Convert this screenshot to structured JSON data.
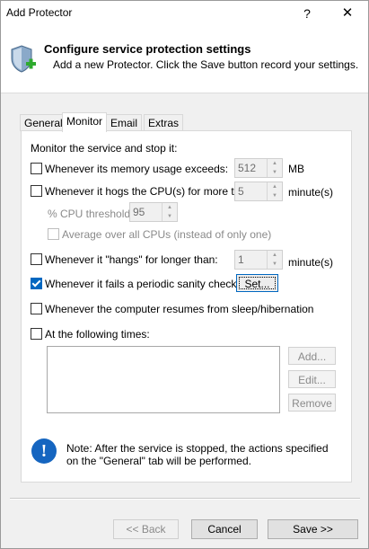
{
  "window": {
    "title": "Add Protector",
    "help_label": "?",
    "close_label": "✕"
  },
  "header": {
    "title": "Configure service protection settings",
    "subtitle": "Add a new Protector. Click the Save button record your settings."
  },
  "tabs": [
    {
      "label": "General",
      "active": false
    },
    {
      "label": "Monitor",
      "active": true
    },
    {
      "label": "Email",
      "active": false
    },
    {
      "label": "Extras",
      "active": false
    }
  ],
  "monitor": {
    "intro": "Monitor the service and stop it:",
    "memory": {
      "label": "Whenever its memory usage exceeds:",
      "checked": false,
      "value": "512",
      "unit": "MB"
    },
    "cpu": {
      "label": "Whenever it hogs the CPU(s) for more than:",
      "checked": false,
      "value": "5",
      "unit": "minute(s)"
    },
    "cpu_threshold": {
      "label": "% CPU threshold:",
      "value": "95"
    },
    "average_cpus": {
      "label": "Average over all CPUs (instead of only one)",
      "checked": false
    },
    "hangs": {
      "label": "Whenever it \"hangs\" for longer than:",
      "checked": false,
      "value": "1",
      "unit": "minute(s)"
    },
    "sanity": {
      "label": "Whenever it fails a periodic sanity check",
      "checked": true,
      "button": "Set..."
    },
    "resume": {
      "label": "Whenever the computer resumes from sleep/hibernation",
      "checked": false
    },
    "times": {
      "label": "At the following times:",
      "checked": false,
      "add": "Add...",
      "edit": "Edit...",
      "remove": "Remove"
    },
    "note": "Note: After the service is stopped, the actions specified on the \"General\" tab will be performed."
  },
  "footer": {
    "back": "<< Back",
    "cancel": "Cancel",
    "save": "Save >>"
  },
  "colors": {
    "accent": "#0067c0",
    "info": "#1565c0",
    "shield": "#8aa9c9",
    "plus": "#2eaa2e"
  }
}
